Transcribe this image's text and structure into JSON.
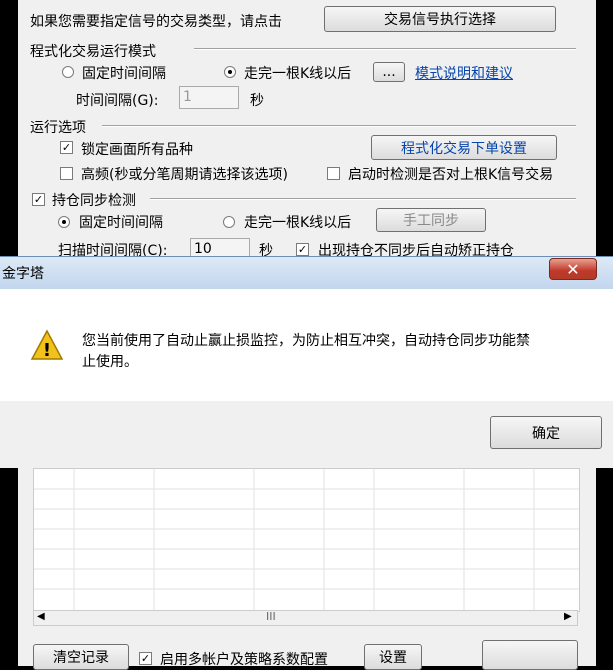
{
  "settings": {
    "signal_type_prompt": "如果您需要指定信号的交易类型，请点击",
    "signal_exec_button": "交易信号执行选择",
    "mode_group_label": "程式化交易运行模式",
    "mode_fixed_interval": "固定时间间隔",
    "mode_after_kline": "走完一根K线以后",
    "dots_button": "...",
    "mode_help_link": "模式说明和建议",
    "interval_label": "时间间隔(G):",
    "interval_value": "1",
    "interval_unit": "秒",
    "run_options_label": "运行选项",
    "lock_screen_label": "锁定画面所有品种",
    "order_settings_button": "程式化交易下单设置",
    "high_freq_label": "高频(秒或分笔周期请选择该选项)",
    "startup_check_label": "启动时检测是否对上根K信号交易",
    "position_sync_label": "持仓同步检测",
    "sync_fixed_interval": "固定时间间隔",
    "sync_after_kline": "走完一根K线以后",
    "manual_sync_button": "手工同步",
    "scan_interval_label": "扫描时间间隔(C):",
    "scan_interval_value": "10",
    "scan_unit": "秒",
    "auto_fix_label": "出现持仓不同步后自动矫正持仓",
    "hscroll_thumb": "III",
    "clear_log_button": "清空记录",
    "multi_account_label": "启用多帐户及策略系数配置",
    "config_button": "设置"
  },
  "alert": {
    "title": "金字塔",
    "message_line1": "您当前使用了自动止赢止损监控，为防止相互冲突，自动持仓同步功能禁",
    "message_line2": "止使用。",
    "ok_button": "确定",
    "close_glyph": "✕",
    "warning_glyph": "!"
  }
}
